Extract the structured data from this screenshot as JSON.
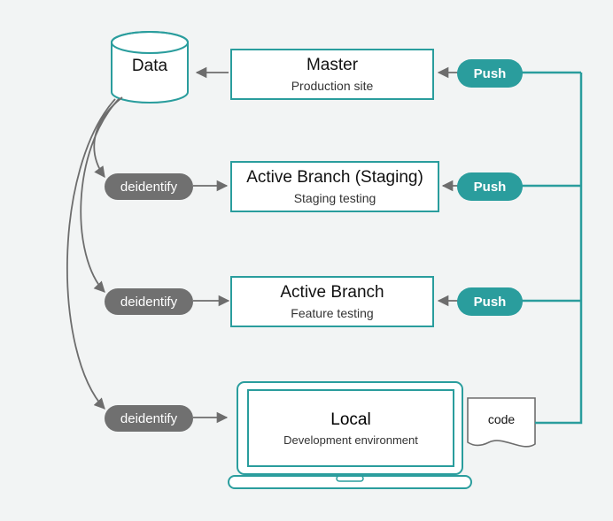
{
  "data_cylinder": {
    "label": "Data"
  },
  "boxes": {
    "master": {
      "title": "Master",
      "sub": "Production site"
    },
    "staging": {
      "title": "Active Branch (Staging)",
      "sub": "Staging testing"
    },
    "feature": {
      "title": "Active Branch",
      "sub": "Feature testing"
    },
    "local": {
      "title": "Local",
      "sub": "Development environment"
    }
  },
  "pills": {
    "push": "Push",
    "deid": "deidentify"
  },
  "code_file": {
    "label": "code"
  },
  "colors": {
    "teal": "#2a9d9d",
    "grey_pill": "#707070",
    "arrow": "#6d6d6d",
    "bg": "#f2f4f4"
  }
}
